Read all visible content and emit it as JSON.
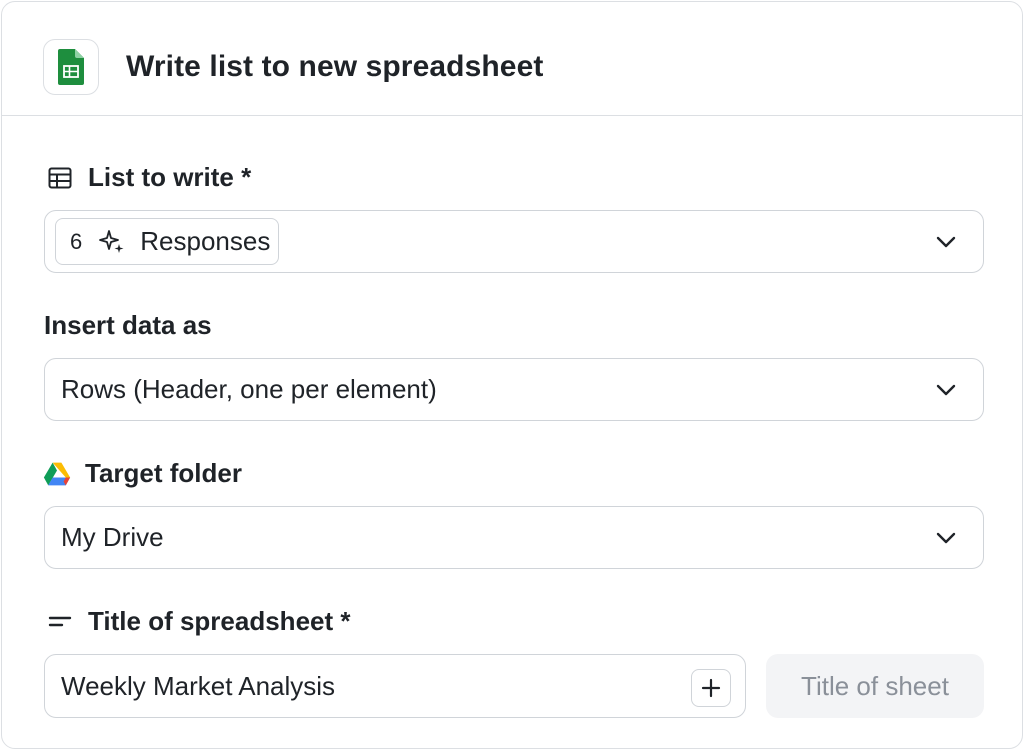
{
  "header": {
    "title": "Write list to new spreadsheet",
    "app_icon": "google-sheets-icon",
    "sheets_color": "#1e8e3e"
  },
  "list_field": {
    "label": "List to write *",
    "icon": "table-icon",
    "chip": {
      "count": "6",
      "icon": "sparkle-icon",
      "label": "Responses"
    }
  },
  "insert_field": {
    "label": "Insert data as",
    "value": "Rows (Header, one per element)"
  },
  "folder_field": {
    "label": "Target folder",
    "icon": "google-drive-icon",
    "value": "My Drive"
  },
  "title_field": {
    "label": "Title of spreadsheet *",
    "icon": "text-lines-icon",
    "value": "Weekly Market Analysis",
    "sheet_placeholder": "Title of sheet"
  },
  "colors": {
    "border": "#d0d4d9",
    "text": "#1f2328",
    "muted": "#8a9099",
    "placeholder_bg": "#f3f4f6"
  }
}
